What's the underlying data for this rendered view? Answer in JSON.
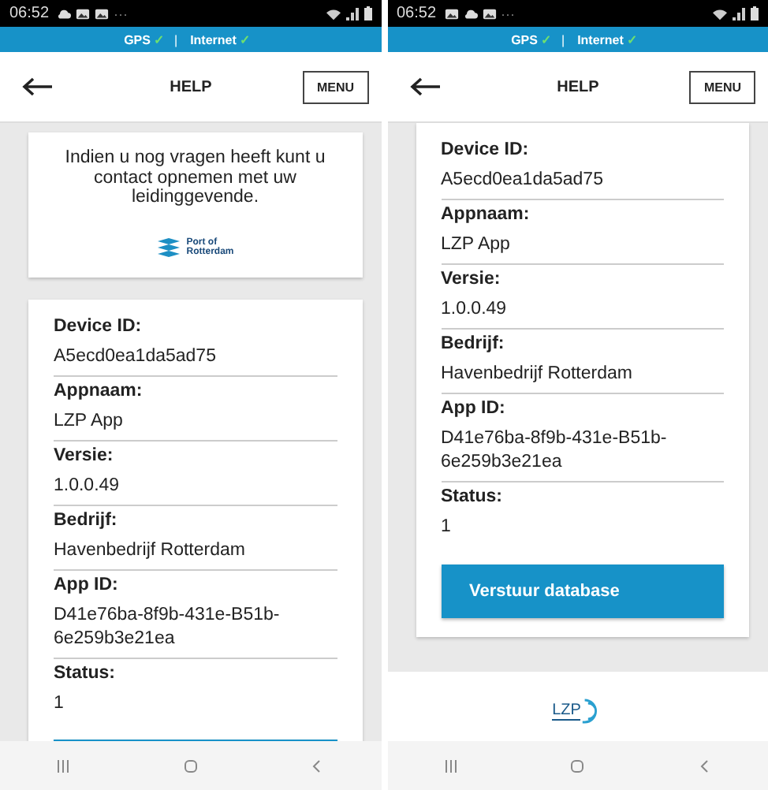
{
  "screens": [
    {
      "status_bar": {
        "time": "06:52",
        "notification_icons": [
          {
            "kind": "cloud"
          },
          {
            "kind": "image"
          },
          {
            "kind": "image"
          }
        ],
        "more": "···"
      },
      "connection_bar": {
        "gps": "GPS",
        "gps_check": "✓",
        "separator": "|",
        "internet": "Internet",
        "internet_check": "✓"
      },
      "header": {
        "title": "HELP",
        "menu_button": "MENU"
      },
      "content": [
        {
          "kind": "info_card",
          "text": "Indien u nog vragen heeft kunt u contact opnemen met uw leidinggevende.",
          "logo_lines": [
            "Port of",
            "Rotterdam"
          ]
        },
        {
          "kind": "details_card",
          "fields": [
            {
              "label": "Device ID:",
              "value": "A5ecd0ea1da5ad75"
            },
            {
              "label": "Appnaam:",
              "value": "LZP App"
            },
            {
              "label": "Versie:",
              "value": "1.0.0.49"
            },
            {
              "label": "Bedrijf:",
              "value": "Havenbedrijf Rotterdam"
            },
            {
              "label": "App ID:",
              "value": "D41e76ba-8f9b-431e-B51b-6e259b3e21ea"
            },
            {
              "label": "Status:",
              "value": "1"
            }
          ],
          "partial_button": true
        }
      ]
    },
    {
      "status_bar": {
        "time": "06:52",
        "notification_icons": [
          {
            "kind": "image"
          },
          {
            "kind": "cloud"
          },
          {
            "kind": "image"
          }
        ],
        "more": "···"
      },
      "connection_bar": {
        "gps": "GPS",
        "gps_check": "✓",
        "separator": "|",
        "internet": "Internet",
        "internet_check": "✓"
      },
      "header": {
        "title": "HELP",
        "menu_button": "MENU"
      },
      "content": [
        {
          "kind": "details_card",
          "fields": [
            {
              "label": "Device ID:",
              "value": "A5ecd0ea1da5ad75"
            },
            {
              "label": "Appnaam:",
              "value": "LZP App"
            },
            {
              "label": "Versie:",
              "value": "1.0.0.49"
            },
            {
              "label": "Bedrijf:",
              "value": "Havenbedrijf Rotterdam"
            },
            {
              "label": "App ID:",
              "value": "D41e76ba-8f9b-431e-B51b-6e259b3e21ea"
            },
            {
              "label": "Status:",
              "value": "1"
            }
          ],
          "button": {
            "label": "Verstuur database"
          }
        },
        {
          "kind": "footer_logo",
          "logo_text": "LZP"
        }
      ]
    }
  ]
}
